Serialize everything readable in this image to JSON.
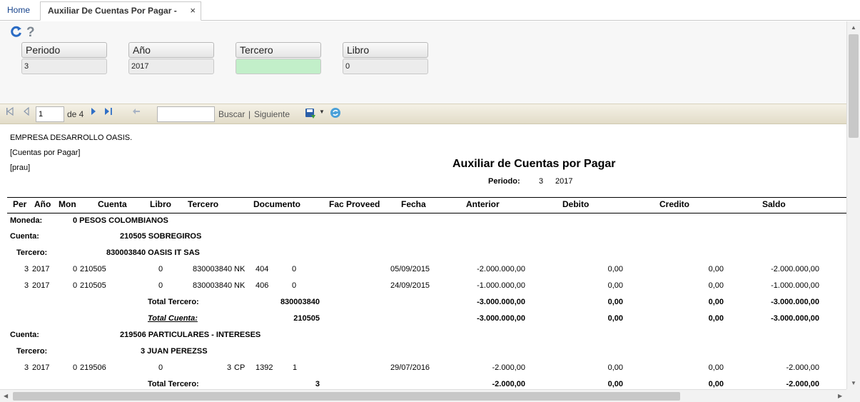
{
  "tabs": {
    "home": "Home",
    "active": "Auxiliar De Cuentas Por Pagar -[prau]",
    "close": "×"
  },
  "toolbar": {
    "refresh_icon": "refresh-icon",
    "help_icon": "help-icon"
  },
  "params": {
    "periodo_label": "Periodo",
    "periodo_value": "3",
    "anio_label": "Año",
    "anio_value": "2017",
    "tercero_label": "Tercero",
    "tercero_value": "",
    "libro_label": "Libro",
    "libro_value": "0"
  },
  "report_toolbar": {
    "page": "1",
    "of_pages": "de 4",
    "search": "Buscar",
    "separator": "|",
    "next": "Siguiente"
  },
  "report": {
    "company": "EMPRESA DESARROLLO OASIS.",
    "subtitle": "[Cuentas por Pagar]",
    "user": "[prau]",
    "title": "Auxiliar de Cuentas por Pagar",
    "period_label": "Periodo:",
    "period": "3",
    "year": "2017",
    "columns": [
      "Per",
      "Año",
      "Mon",
      "Cuenta",
      "Libro",
      "Tercero",
      "Documento",
      "Fac Proveed",
      "Fecha",
      "Anterior",
      "Debito",
      "Credito",
      "Saldo"
    ],
    "moneda_label": "Moneda:",
    "moneda_value": "0 PESOS COLOMBIANOS",
    "cuenta_label": "Cuenta:",
    "tercero_label": "Tercero:",
    "total_tercero_label": "Total Tercero:",
    "total_cuenta_label": "Total Cuenta:",
    "group1": {
      "cuenta": "210505 SOBREGIROS",
      "tercero": "830003840 OASIS IT SAS",
      "rows": [
        {
          "per": "3",
          "anio": "2017",
          "mon": "0",
          "cuenta": "210505",
          "libro": "0",
          "tercero": "830003840",
          "tipo": "NK",
          "doc": "404",
          "fac": "0",
          "fecha": "05/09/2015",
          "anterior": "-2.000.000,00",
          "debito": "0,00",
          "credito": "0,00",
          "saldo": "-2.000.000,00"
        },
        {
          "per": "3",
          "anio": "2017",
          "mon": "0",
          "cuenta": "210505",
          "libro": "0",
          "tercero": "830003840",
          "tipo": "NK",
          "doc": "406",
          "fac": "0",
          "fecha": "24/09/2015",
          "anterior": "-1.000.000,00",
          "debito": "0,00",
          "credito": "0,00",
          "saldo": "-1.000.000,00"
        }
      ],
      "total_tercero": {
        "id": "830003840",
        "anterior": "-3.000.000,00",
        "debito": "0,00",
        "credito": "0,00",
        "saldo": "-3.000.000,00"
      },
      "total_cuenta": {
        "id": "210505",
        "anterior": "-3.000.000,00",
        "debito": "0,00",
        "credito": "0,00",
        "saldo": "-3.000.000,00"
      }
    },
    "group2": {
      "cuenta": "219506 PARTICULARES - INTERESES",
      "tercero": "3 JUAN PEREZSS",
      "rows": [
        {
          "per": "3",
          "anio": "2017",
          "mon": "0",
          "cuenta": "219506",
          "libro": "0",
          "tercero": "3",
          "tipo": "CP",
          "doc": "1392",
          "fac": "1",
          "fecha": "29/07/2016",
          "anterior": "-2.000,00",
          "debito": "0,00",
          "credito": "0,00",
          "saldo": "-2.000,00"
        }
      ],
      "total_tercero": {
        "id": "3",
        "anterior": "-2.000,00",
        "debito": "0,00",
        "credito": "0,00",
        "saldo": "-2.000,00"
      }
    }
  }
}
